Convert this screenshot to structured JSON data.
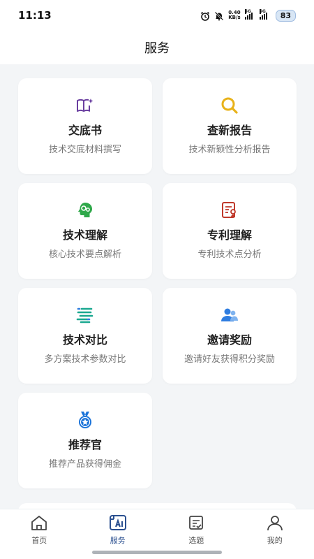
{
  "status_bar": {
    "time": "11:13",
    "speed_value": "0.40",
    "speed_unit": "KB/s",
    "network_1": "5G",
    "network_2": "5G",
    "battery": "83"
  },
  "header": {
    "title": "服务"
  },
  "cards": [
    {
      "icon": "book-sparkle-icon",
      "title": "交底书",
      "desc": "技术交底材料撰写",
      "color": "#6a3fa0"
    },
    {
      "icon": "search-icon",
      "title": "查新报告",
      "desc": "技术新颖性分析报告",
      "color": "#e8b21a"
    },
    {
      "icon": "brain-gear-icon",
      "title": "技术理解",
      "desc": "核心技术要点解析",
      "color": "#2fa84a"
    },
    {
      "icon": "patent-document-icon",
      "title": "专利理解",
      "desc": "专利技术点分析",
      "color": "#c0392b"
    },
    {
      "icon": "compare-bars-icon",
      "title": "技术对比",
      "desc": "多方案技术参数对比",
      "color": "#1aa890"
    },
    {
      "icon": "invite-users-icon",
      "title": "邀请奖励",
      "desc": "邀请好友获得积分奖励",
      "color": "#2f7de0"
    },
    {
      "icon": "medal-star-icon",
      "title": "推荐官",
      "desc": "推荐产品获得佣金",
      "color": "#1a73d9"
    }
  ],
  "bottom_nav": [
    {
      "icon": "home-icon",
      "label": "首页",
      "active": false
    },
    {
      "icon": "ai-service-icon",
      "label": "服务",
      "active": true
    },
    {
      "icon": "checklist-icon",
      "label": "选题",
      "active": false
    },
    {
      "icon": "user-icon",
      "label": "我的",
      "active": false
    }
  ],
  "colors": {
    "accent": "#2a4f8f",
    "background": "#f3f5f7",
    "card": "#ffffff"
  }
}
